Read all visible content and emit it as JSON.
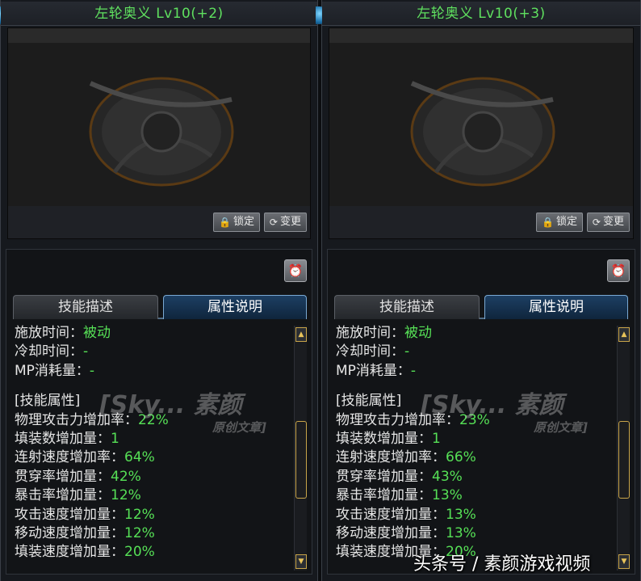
{
  "panels": [
    {
      "title": "左轮奥义 Lv10(+2)",
      "lock_label": "锁定",
      "change_label": "变更",
      "tab_desc": "技能描述",
      "tab_attr": "属性说明",
      "cast_label": "施放时间",
      "cast_value": "被动",
      "cooldown_label": "冷却时间",
      "cooldown_value": "-",
      "mp_label": "MP消耗量",
      "mp_value": "-",
      "section": "[技能属性]",
      "attrs": [
        {
          "label": "物理攻击力增加率",
          "value": "22%"
        },
        {
          "label": "填装数增加量",
          "value": "1"
        },
        {
          "label": "连射速度增加率",
          "value": "64%"
        },
        {
          "label": "贯穿率增加量",
          "value": "42%"
        },
        {
          "label": "暴击率增加量",
          "value": "12%"
        },
        {
          "label": "攻击速度增加量",
          "value": "12%"
        },
        {
          "label": "移动速度增加量",
          "value": "12%"
        },
        {
          "label": "填装速度增加量",
          "value": "20%"
        }
      ]
    },
    {
      "title": "左轮奥义 Lv10(+3)",
      "lock_label": "锁定",
      "change_label": "变更",
      "tab_desc": "技能描述",
      "tab_attr": "属性说明",
      "cast_label": "施放时间",
      "cast_value": "被动",
      "cooldown_label": "冷却时间",
      "cooldown_value": "-",
      "mp_label": "MP消耗量",
      "mp_value": "-",
      "section": "[技能属性]",
      "attrs": [
        {
          "label": "物理攻击力增加率",
          "value": "23%"
        },
        {
          "label": "填装数增加量",
          "value": "1"
        },
        {
          "label": "连射速度增加率",
          "value": "66%"
        },
        {
          "label": "贯穿率增加量",
          "value": "43%"
        },
        {
          "label": "暴击率增加量",
          "value": "13%"
        },
        {
          "label": "攻击速度增加量",
          "value": "13%"
        },
        {
          "label": "移动速度增加量",
          "value": "13%"
        },
        {
          "label": "填装速度增加量",
          "value": "20%"
        }
      ]
    }
  ],
  "watermark": {
    "main": "[Sky... 素颜",
    "sub": "原创文章]"
  },
  "footer": "头条号 / 素颜游戏视频",
  "colors": {
    "title": "#5fe05f",
    "value": "#56e056",
    "active_tab": "#1d3f63"
  },
  "icons": {
    "lock": "lock-icon",
    "change": "refresh-icon",
    "clock": "clock-icon",
    "scroll_up": "triangle-up-icon",
    "scroll_down": "triangle-down-icon"
  }
}
